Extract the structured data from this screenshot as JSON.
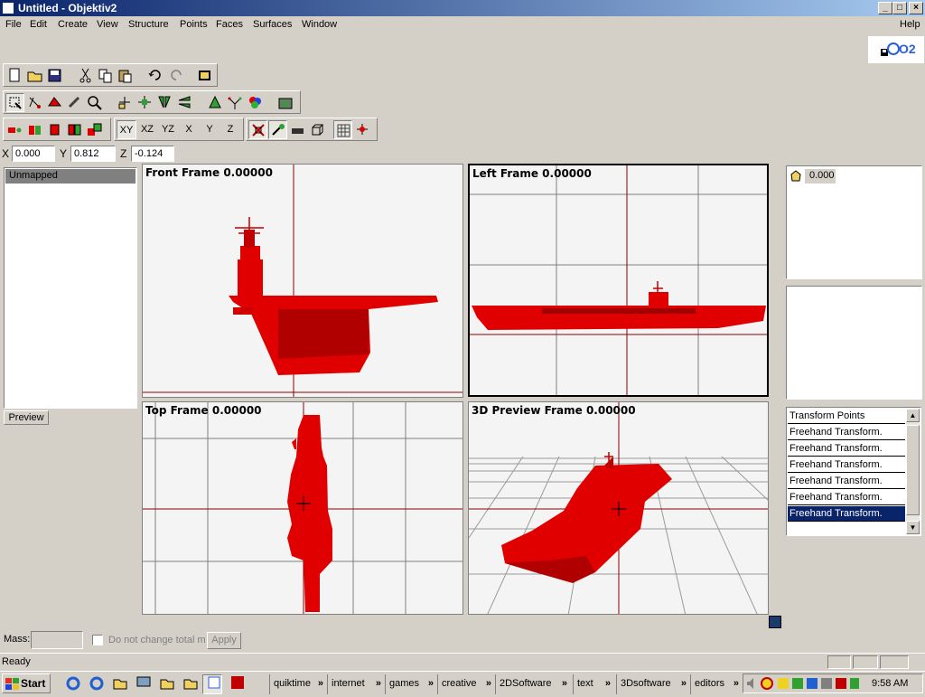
{
  "window": {
    "title": "Untitled - Objektiv2",
    "min": "_",
    "max": "□",
    "close": "×"
  },
  "menu": {
    "items": [
      "File",
      "Edit",
      "Create",
      "View",
      "Structure",
      "Points",
      "Faces",
      "Surfaces",
      "Window"
    ],
    "help": "Help"
  },
  "logo": {
    "text": "O2"
  },
  "toolbar": {
    "plane_buttons": [
      "XY",
      "XZ",
      "YZ",
      "X",
      "Y",
      "Z"
    ],
    "active_plane": "XY",
    "icons_row1": [
      "new-icon",
      "open-icon",
      "save-icon",
      "cut-icon",
      "copy-icon",
      "paste-icon",
      "undo-icon",
      "redo-icon",
      "properties-icon"
    ],
    "icons_row2": [
      "select-icon",
      "select-points-icon",
      "select-faces-icon",
      "rotate-view-icon",
      "zoom-icon",
      "move-icon",
      "scale-icon",
      "mirror-icon",
      "flip-icon",
      "triangle-icon",
      "normals-icon",
      "color-wheel-icon",
      "render-icon"
    ],
    "icons_row3": [
      "lock-icon",
      "solid-icon",
      "red-cube-icon",
      "stack-icon",
      "group-icon",
      "hide-selection-icon",
      "light-icon",
      "shade-icon",
      "cube-icon",
      "grid-icon",
      "snap-icon"
    ]
  },
  "coords": {
    "x_label": "X",
    "x": "0.000",
    "y_label": "Y",
    "y": "0.812",
    "z_label": "Z",
    "z": "-0.124"
  },
  "left_panel": {
    "header": "Unmapped",
    "preview_button": "Preview"
  },
  "viewports": {
    "front": "Front Frame 0.00000",
    "left": "Left Frame 0.00000",
    "top": "Top Frame 0.00000",
    "preview": "3D Preview Frame 0.00000"
  },
  "right_panel": {
    "frame_value": "0.000",
    "transforms": [
      "Transform Points",
      "Freehand Transform.",
      "Freehand Transform.",
      "Freehand Transform.",
      "Freehand Transform.",
      "Freehand Transform.",
      "Freehand Transform."
    ],
    "selected_index": 6,
    "scroll_up": "▲",
    "scroll_down": "▼"
  },
  "bottom": {
    "mass_label": "Mass:",
    "mass_value": "",
    "checkbox_label": "Do not change total ma",
    "apply": "Apply"
  },
  "status": {
    "text": "Ready"
  },
  "taskbar": {
    "start": "Start",
    "groups": [
      "quiktime",
      "internet",
      "games",
      "creative",
      "2DSoftware",
      "text",
      "3Dsoftware",
      "editors"
    ],
    "chevron": "»",
    "time": "9:58 AM"
  },
  "colors": {
    "model": "#e00000",
    "model_dark": "#b00000",
    "axis": "#8b0000",
    "grid": "#7f7f7f",
    "selection": "#0a246a",
    "desktop": "#d4d0c8"
  }
}
